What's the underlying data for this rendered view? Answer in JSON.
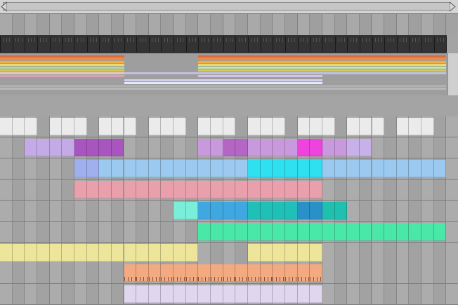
{
  "colors": {
    "background": "#a4a4a4",
    "cell_light": "#acacac",
    "cell_dark": "#9b9b9b",
    "ruler": "#333333"
  },
  "lanes": [
    {
      "id": "overview-top",
      "clips": []
    },
    {
      "id": "white-track",
      "color": "#ebebeb",
      "clips": [
        [
          0,
          3
        ],
        [
          4,
          7
        ],
        [
          8,
          11
        ],
        [
          12,
          15
        ],
        [
          16,
          19
        ],
        [
          20,
          23
        ],
        [
          24,
          27
        ],
        [
          28,
          31
        ],
        [
          32,
          35
        ]
      ]
    },
    {
      "id": "lavender-track",
      "clips": [
        [
          2,
          6,
          "#c5aae8"
        ],
        [
          6,
          10,
          "#a955c0"
        ],
        [
          16,
          18,
          "#c999dd"
        ],
        [
          18,
          20,
          "#b366c4"
        ],
        [
          20,
          24,
          "#c999dd"
        ],
        [
          24,
          26,
          "#ee44dd"
        ],
        [
          26,
          28,
          "#c999dd"
        ],
        [
          28,
          30,
          "#c8b0ea"
        ]
      ]
    },
    {
      "id": "blue-track",
      "clips": [
        [
          6,
          8,
          "#a0b0ee"
        ],
        [
          8,
          12,
          "#9cc9f0"
        ],
        [
          12,
          20,
          "#9cc9f0"
        ],
        [
          20,
          26,
          "#2ee0f0"
        ],
        [
          26,
          32,
          "#9cc9f0"
        ],
        [
          32,
          36,
          "#9cc9f0"
        ]
      ]
    },
    {
      "id": "pink-track",
      "color": "#eaa0ac",
      "clips": [
        [
          6,
          26
        ]
      ]
    },
    {
      "id": "cyan-track",
      "clips": [
        [
          14,
          16,
          "#7aeed8"
        ],
        [
          16,
          20,
          "#40a8e0"
        ],
        [
          20,
          24,
          "#20c0b8"
        ],
        [
          24,
          26,
          "#2a90c8"
        ],
        [
          26,
          28,
          "#20c0b0"
        ]
      ]
    },
    {
      "id": "green-track",
      "color": "#4ae8a8",
      "clips": [
        [
          16,
          36
        ]
      ]
    },
    {
      "id": "yellow-track",
      "color": "#ede59a",
      "clips": [
        [
          0,
          16
        ],
        [
          20,
          26
        ]
      ]
    },
    {
      "id": "orange-track",
      "color": "#f3aa80",
      "clips": [
        [
          10,
          26
        ]
      ]
    },
    {
      "id": "lilac-track",
      "color": "#e0d6ee",
      "clips": [
        [
          10,
          26
        ]
      ]
    }
  ]
}
